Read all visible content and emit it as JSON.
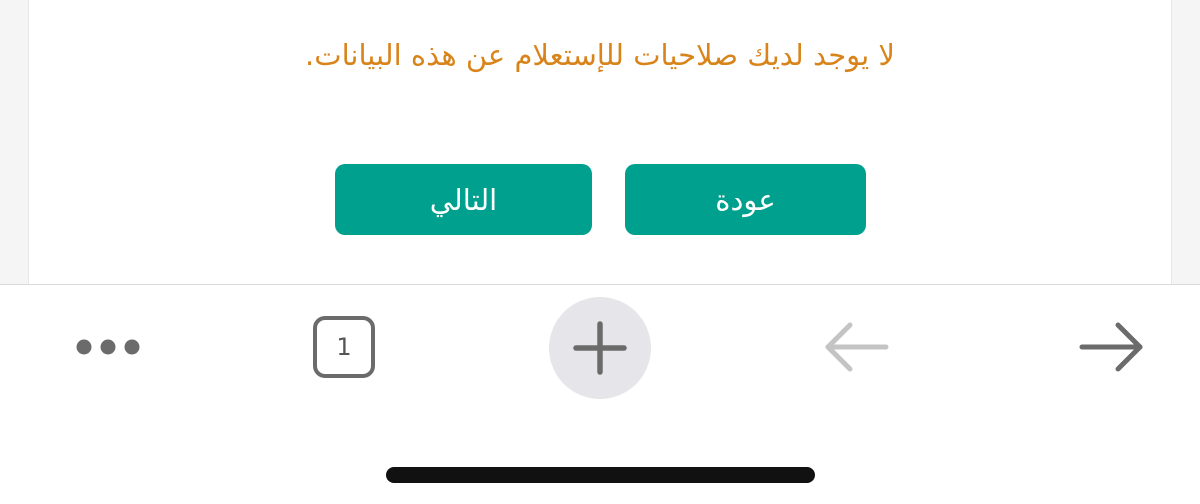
{
  "colors": {
    "message_text": "#d9841b",
    "button_background": "#00a08e",
    "icon_dark": "#6b6b6b",
    "icon_disabled": "#c4c4c4",
    "new_tab_circle": "#e6e6ea"
  },
  "dialog": {
    "message": "لا يوجد لديك صلاحيات للإستعلام عن هذه البيانات.",
    "back_button_label": "عودة",
    "next_button_label": "التالي"
  },
  "browser_toolbar": {
    "tab_count": "1",
    "icons": {
      "more": "ellipsis-icon",
      "tabs": "tabs-icon",
      "new_tab": "plus-icon",
      "back": "arrow-left-icon",
      "forward": "arrow-right-icon"
    },
    "back_enabled": false,
    "forward_enabled": true
  }
}
